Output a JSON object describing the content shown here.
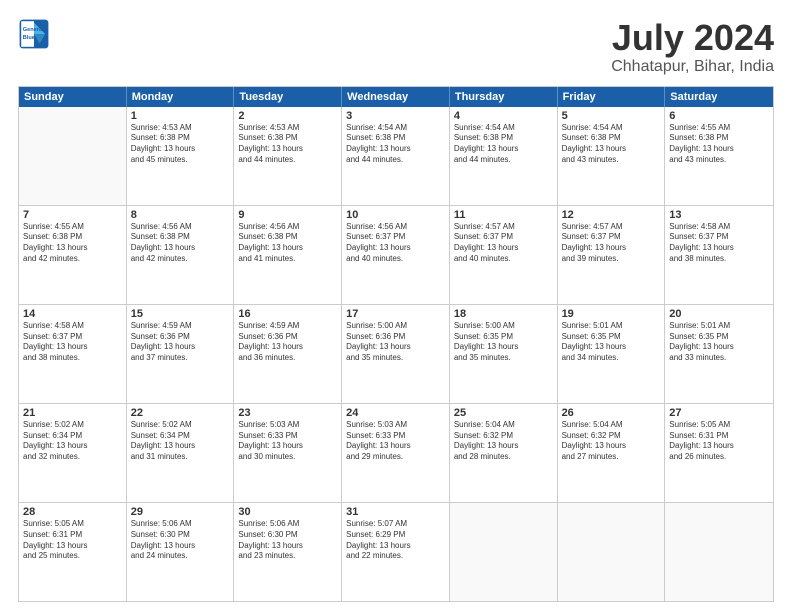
{
  "header": {
    "logo_line1": "General",
    "logo_line2": "Blue",
    "title": "July 2024",
    "subtitle": "Chhatapur, Bihar, India"
  },
  "calendar": {
    "days": [
      "Sunday",
      "Monday",
      "Tuesday",
      "Wednesday",
      "Thursday",
      "Friday",
      "Saturday"
    ],
    "rows": [
      [
        {
          "num": "",
          "text": ""
        },
        {
          "num": "1",
          "text": "Sunrise: 4:53 AM\nSunset: 6:38 PM\nDaylight: 13 hours\nand 45 minutes."
        },
        {
          "num": "2",
          "text": "Sunrise: 4:53 AM\nSunset: 6:38 PM\nDaylight: 13 hours\nand 44 minutes."
        },
        {
          "num": "3",
          "text": "Sunrise: 4:54 AM\nSunset: 6:38 PM\nDaylight: 13 hours\nand 44 minutes."
        },
        {
          "num": "4",
          "text": "Sunrise: 4:54 AM\nSunset: 6:38 PM\nDaylight: 13 hours\nand 44 minutes."
        },
        {
          "num": "5",
          "text": "Sunrise: 4:54 AM\nSunset: 6:38 PM\nDaylight: 13 hours\nand 43 minutes."
        },
        {
          "num": "6",
          "text": "Sunrise: 4:55 AM\nSunset: 6:38 PM\nDaylight: 13 hours\nand 43 minutes."
        }
      ],
      [
        {
          "num": "7",
          "text": "Sunrise: 4:55 AM\nSunset: 6:38 PM\nDaylight: 13 hours\nand 42 minutes."
        },
        {
          "num": "8",
          "text": "Sunrise: 4:56 AM\nSunset: 6:38 PM\nDaylight: 13 hours\nand 42 minutes."
        },
        {
          "num": "9",
          "text": "Sunrise: 4:56 AM\nSunset: 6:38 PM\nDaylight: 13 hours\nand 41 minutes."
        },
        {
          "num": "10",
          "text": "Sunrise: 4:56 AM\nSunset: 6:37 PM\nDaylight: 13 hours\nand 40 minutes."
        },
        {
          "num": "11",
          "text": "Sunrise: 4:57 AM\nSunset: 6:37 PM\nDaylight: 13 hours\nand 40 minutes."
        },
        {
          "num": "12",
          "text": "Sunrise: 4:57 AM\nSunset: 6:37 PM\nDaylight: 13 hours\nand 39 minutes."
        },
        {
          "num": "13",
          "text": "Sunrise: 4:58 AM\nSunset: 6:37 PM\nDaylight: 13 hours\nand 38 minutes."
        }
      ],
      [
        {
          "num": "14",
          "text": "Sunrise: 4:58 AM\nSunset: 6:37 PM\nDaylight: 13 hours\nand 38 minutes."
        },
        {
          "num": "15",
          "text": "Sunrise: 4:59 AM\nSunset: 6:36 PM\nDaylight: 13 hours\nand 37 minutes."
        },
        {
          "num": "16",
          "text": "Sunrise: 4:59 AM\nSunset: 6:36 PM\nDaylight: 13 hours\nand 36 minutes."
        },
        {
          "num": "17",
          "text": "Sunrise: 5:00 AM\nSunset: 6:36 PM\nDaylight: 13 hours\nand 35 minutes."
        },
        {
          "num": "18",
          "text": "Sunrise: 5:00 AM\nSunset: 6:35 PM\nDaylight: 13 hours\nand 35 minutes."
        },
        {
          "num": "19",
          "text": "Sunrise: 5:01 AM\nSunset: 6:35 PM\nDaylight: 13 hours\nand 34 minutes."
        },
        {
          "num": "20",
          "text": "Sunrise: 5:01 AM\nSunset: 6:35 PM\nDaylight: 13 hours\nand 33 minutes."
        }
      ],
      [
        {
          "num": "21",
          "text": "Sunrise: 5:02 AM\nSunset: 6:34 PM\nDaylight: 13 hours\nand 32 minutes."
        },
        {
          "num": "22",
          "text": "Sunrise: 5:02 AM\nSunset: 6:34 PM\nDaylight: 13 hours\nand 31 minutes."
        },
        {
          "num": "23",
          "text": "Sunrise: 5:03 AM\nSunset: 6:33 PM\nDaylight: 13 hours\nand 30 minutes."
        },
        {
          "num": "24",
          "text": "Sunrise: 5:03 AM\nSunset: 6:33 PM\nDaylight: 13 hours\nand 29 minutes."
        },
        {
          "num": "25",
          "text": "Sunrise: 5:04 AM\nSunset: 6:32 PM\nDaylight: 13 hours\nand 28 minutes."
        },
        {
          "num": "26",
          "text": "Sunrise: 5:04 AM\nSunset: 6:32 PM\nDaylight: 13 hours\nand 27 minutes."
        },
        {
          "num": "27",
          "text": "Sunrise: 5:05 AM\nSunset: 6:31 PM\nDaylight: 13 hours\nand 26 minutes."
        }
      ],
      [
        {
          "num": "28",
          "text": "Sunrise: 5:05 AM\nSunset: 6:31 PM\nDaylight: 13 hours\nand 25 minutes."
        },
        {
          "num": "29",
          "text": "Sunrise: 5:06 AM\nSunset: 6:30 PM\nDaylight: 13 hours\nand 24 minutes."
        },
        {
          "num": "30",
          "text": "Sunrise: 5:06 AM\nSunset: 6:30 PM\nDaylight: 13 hours\nand 23 minutes."
        },
        {
          "num": "31",
          "text": "Sunrise: 5:07 AM\nSunset: 6:29 PM\nDaylight: 13 hours\nand 22 minutes."
        },
        {
          "num": "",
          "text": ""
        },
        {
          "num": "",
          "text": ""
        },
        {
          "num": "",
          "text": ""
        }
      ]
    ]
  }
}
